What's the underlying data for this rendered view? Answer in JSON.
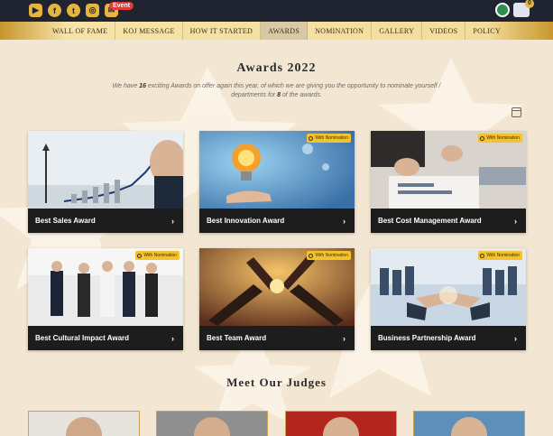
{
  "topbar": {
    "social_icons": [
      "youtube-icon",
      "facebook-icon",
      "twitter-icon",
      "instagram-icon",
      "mail-icon"
    ],
    "event_badge": "Event",
    "cart_count": "0"
  },
  "nav": {
    "items": [
      "WALL OF FAME",
      "KOJ MESSAGE",
      "HOW IT STARTED",
      "AWARDS",
      "NOMINATION",
      "GALLERY",
      "VIDEOS",
      "POLICY"
    ],
    "active": "AWARDS"
  },
  "page": {
    "title": "Awards 2022",
    "intro_prefix": "We have ",
    "intro_count": "16",
    "intro_middle": " exciting Awards on offer again this year, of which we are giving you the opportunity to nominate yourself / departments for ",
    "intro_count2": "8",
    "intro_suffix": " of the awards."
  },
  "badge_text": "With Nomination",
  "awards": [
    {
      "title": "Best Sales Award",
      "nomination": false
    },
    {
      "title": "Best Innovation Award",
      "nomination": true
    },
    {
      "title": "Best Cost Management Award",
      "nomination": true
    },
    {
      "title": "Best Cultural Impact Award",
      "nomination": true
    },
    {
      "title": "Best Team Award",
      "nomination": true
    },
    {
      "title": "Business Partnership Award",
      "nomination": true
    }
  ],
  "judges": {
    "title": "Meet Our Judges"
  },
  "colors": {
    "accent": "#e5b540",
    "topbar": "#1f2430",
    "background": "#f3e6d2",
    "card_bar": "#1d1d1d",
    "badge": "#f2c230"
  }
}
